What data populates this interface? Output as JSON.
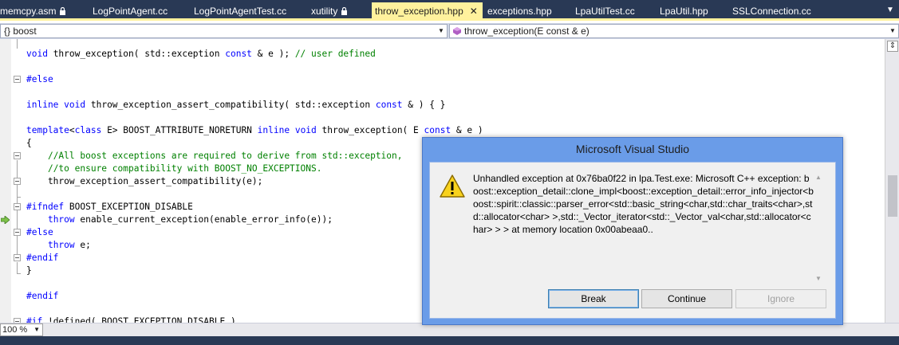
{
  "tabs": [
    {
      "label": "memcpy.asm",
      "locked": true,
      "active": false
    },
    {
      "label": "LogPointAgent.cc",
      "locked": false,
      "active": false
    },
    {
      "label": "LogPointAgentTest.cc",
      "locked": false,
      "active": false
    },
    {
      "label": "xutility",
      "locked": true,
      "active": false
    },
    {
      "label": "throw_exception.hpp",
      "locked": false,
      "active": true,
      "close_glyph": "✕"
    },
    {
      "label": "exceptions.hpp",
      "locked": false,
      "active": false
    },
    {
      "label": "LpaUtilTest.cc",
      "locked": false,
      "active": false
    },
    {
      "label": "LpaUtil.hpp",
      "locked": false,
      "active": false
    },
    {
      "label": "SSLConnection.cc",
      "locked": false,
      "active": false
    }
  ],
  "navbar": {
    "scope": "{} boost",
    "member": "throw_exception(E const & e)"
  },
  "editor": {
    "zoom": "100 %",
    "lines": [
      [
        {
          "t": "void",
          "c": "kw"
        },
        {
          "t": " throw_exception( std::exception "
        },
        {
          "t": "const",
          "c": "kw"
        },
        {
          "t": " & e ); "
        },
        {
          "t": "// user defined",
          "c": "cm"
        }
      ],
      [],
      [
        {
          "t": "#else",
          "c": "pp"
        }
      ],
      [],
      [
        {
          "t": "inline",
          "c": "kw"
        },
        {
          "t": " "
        },
        {
          "t": "void",
          "c": "kw"
        },
        {
          "t": " throw_exception_assert_compatibility( std::exception "
        },
        {
          "t": "const",
          "c": "kw"
        },
        {
          "t": " & ) { }"
        }
      ],
      [],
      [
        {
          "t": "template",
          "c": "kw"
        },
        {
          "t": "<"
        },
        {
          "t": "class",
          "c": "kw"
        },
        {
          "t": " E> BOOST_ATTRIBUTE_NORETURN "
        },
        {
          "t": "inline",
          "c": "kw"
        },
        {
          "t": " "
        },
        {
          "t": "void",
          "c": "kw"
        },
        {
          "t": " throw_exception( E "
        },
        {
          "t": "const",
          "c": "kw"
        },
        {
          "t": " & e )"
        }
      ],
      [
        {
          "t": "{"
        }
      ],
      [
        {
          "t": "    "
        },
        {
          "t": "//All boost exceptions are required to derive from std::exception,",
          "c": "cm"
        }
      ],
      [
        {
          "t": "    "
        },
        {
          "t": "//to ensure compatibility with BOOST_NO_EXCEPTIONS.",
          "c": "cm"
        }
      ],
      [
        {
          "t": "    throw_exception_assert_compatibility(e);"
        }
      ],
      [],
      [
        {
          "t": "#ifndef",
          "c": "pp"
        },
        {
          "t": " BOOST_EXCEPTION_DISABLE"
        }
      ],
      [
        {
          "t": "    "
        },
        {
          "t": "throw",
          "c": "kw"
        },
        {
          "t": " enable_current_exception(enable_error_info(e));"
        }
      ],
      [
        {
          "t": "#else",
          "c": "pp"
        }
      ],
      [
        {
          "t": "    "
        },
        {
          "t": "throw",
          "c": "kw"
        },
        {
          "t": " e;"
        }
      ],
      [
        {
          "t": "#endif",
          "c": "pp"
        }
      ],
      [
        {
          "t": "}"
        }
      ],
      [],
      [
        {
          "t": "#endif",
          "c": "pp"
        }
      ],
      [],
      [
        {
          "t": "#if",
          "c": "pp"
        },
        {
          "t": " !defined( BOOST_EXCEPTION_DISABLE )"
        }
      ]
    ]
  },
  "dialog": {
    "title": "Microsoft Visual Studio",
    "icon": "warning-icon",
    "message": "Unhandled exception at 0x76ba0f22 in lpa.Test.exe: Microsoft C++ exception: boost::exception_detail::clone_impl<boost::exception_detail::error_info_injector<boost::spirit::classic::parser_error<std::basic_string<char,std::char_traits<char>,std::allocator<char> >,std::_Vector_iterator<std::_Vector_val<char,std::allocator<char> > > at memory location 0x00abeaa0..",
    "buttons": {
      "break": "Break",
      "continue": "Continue",
      "ignore": "Ignore"
    }
  },
  "colors": {
    "tab_strip": "#293955",
    "active_tab": "#fff29d",
    "keyword": "#0000ff",
    "comment": "#008000",
    "dialog_frame": "#6a9ce8"
  }
}
